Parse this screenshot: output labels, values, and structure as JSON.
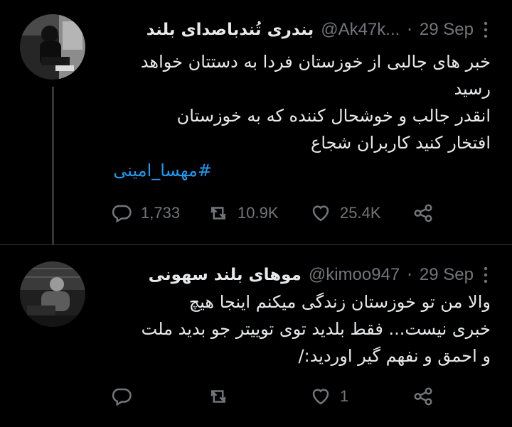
{
  "tweets": [
    {
      "display_name": "بندری تُندباصدای بلند",
      "handle": "@Ak47k...",
      "separator": "·",
      "date": "29 Sep",
      "lines": [
        "خبر های جالبی از خوزستان فردا به دستتان خواهد",
        "رسید",
        "انقدر جالب و خوشحال کننده که به خوزستان",
        "افتخار کنید کاربران شجاع"
      ],
      "hashtag": "#مهسا_امینی",
      "replies": "1,733",
      "retweets": "10.9K",
      "likes": "25.4K"
    },
    {
      "display_name": "موهای بلند سهونی",
      "handle": "@kimoo947",
      "separator": "·",
      "date": "29 Sep",
      "lines": [
        "والا من تو خوزستان زندگی میکنم اینجا هیچ",
        "خبری نیست... فقط بلدید توی توییتر جو بدید ملت",
        "و احمق و نفهم گیر اوردید:/"
      ],
      "replies": "",
      "retweets": "",
      "likes": "1"
    }
  ],
  "icons": {
    "more": "more-icon",
    "reply": "reply-icon",
    "retweet": "retweet-icon",
    "like": "like-icon",
    "share": "share-icon"
  },
  "colors": {
    "background": "#000000",
    "text": "#e7e9ea",
    "secondary": "#71767b",
    "link": "#1d9bf0",
    "divider": "#2f3336"
  }
}
